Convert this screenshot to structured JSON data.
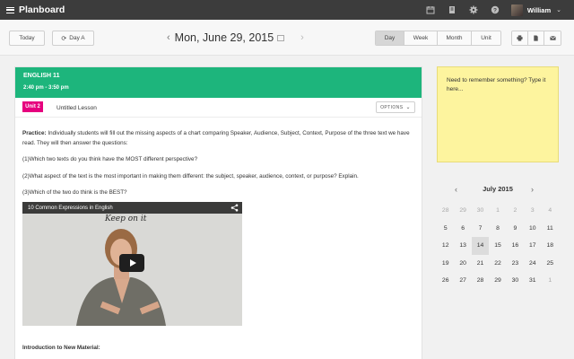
{
  "app": {
    "title": "Planboard",
    "user_name": "William"
  },
  "toolbar": {
    "today_label": "Today",
    "day_cycle_label": "Day A",
    "date_text": "Mon, June 29, 2015",
    "views": [
      "Day",
      "Week",
      "Month",
      "Unit"
    ],
    "active_view": "Day"
  },
  "lesson": {
    "class_name": "ENGLISH 11",
    "time": "2:40 pm - 3:50 pm",
    "unit_badge": "Unit 2",
    "lesson_title": "Untitled Lesson",
    "options_label": "OPTIONS",
    "practice_label": "Practice:",
    "practice_text": " Individually students will fill out the missing aspects of a chart comparing Speaker, Audience, Subject, Context, Purpose of the three text we have read. They will then answer the questions:",
    "q1": "(1)Which two texts do you think have the MOST different perspective?",
    "q2": "(2)What aspect of the text is the most important in making them different: the subject, speaker, audience, context, or purpose? Explain.",
    "q3": "(3)Which of the two do think is the BEST?",
    "video_title": "10 Common Expressions in English",
    "video_board_text": "Keep on it",
    "intro_heading": "Introduction to New Material:",
    "accent_color": "#1db57c",
    "badge_color": "#e6007e"
  },
  "note": {
    "placeholder": "Need to remember something? Type it here..."
  },
  "calendar": {
    "month_label": "July 2015",
    "selected_day": "14",
    "weeks": [
      [
        {
          "d": "28",
          "m": true
        },
        {
          "d": "29",
          "m": true
        },
        {
          "d": "30",
          "m": true
        },
        {
          "d": "1",
          "m": true
        },
        {
          "d": "2",
          "m": true
        },
        {
          "d": "3",
          "m": true
        },
        {
          "d": "4",
          "m": true
        }
      ],
      [
        {
          "d": "5",
          "m": false
        },
        {
          "d": "6",
          "m": false
        },
        {
          "d": "7",
          "m": false
        },
        {
          "d": "8",
          "m": false
        },
        {
          "d": "9",
          "m": false
        },
        {
          "d": "10",
          "m": false
        },
        {
          "d": "11",
          "m": false
        }
      ],
      [
        {
          "d": "12",
          "m": false
        },
        {
          "d": "13",
          "m": false
        },
        {
          "d": "14",
          "m": false
        },
        {
          "d": "15",
          "m": false
        },
        {
          "d": "16",
          "m": false
        },
        {
          "d": "17",
          "m": false
        },
        {
          "d": "18",
          "m": false
        }
      ],
      [
        {
          "d": "19",
          "m": false
        },
        {
          "d": "20",
          "m": false
        },
        {
          "d": "21",
          "m": false
        },
        {
          "d": "22",
          "m": false
        },
        {
          "d": "23",
          "m": false
        },
        {
          "d": "24",
          "m": false
        },
        {
          "d": "25",
          "m": false
        }
      ],
      [
        {
          "d": "26",
          "m": false
        },
        {
          "d": "27",
          "m": false
        },
        {
          "d": "28",
          "m": false
        },
        {
          "d": "29",
          "m": false
        },
        {
          "d": "30",
          "m": false
        },
        {
          "d": "31",
          "m": false
        },
        {
          "d": "1",
          "m": true
        }
      ]
    ]
  },
  "icons": {
    "top": [
      "calendar-icon",
      "book-icon",
      "gear-icon",
      "help-icon"
    ],
    "actions": [
      "print-icon",
      "document-icon",
      "email-icon"
    ]
  }
}
